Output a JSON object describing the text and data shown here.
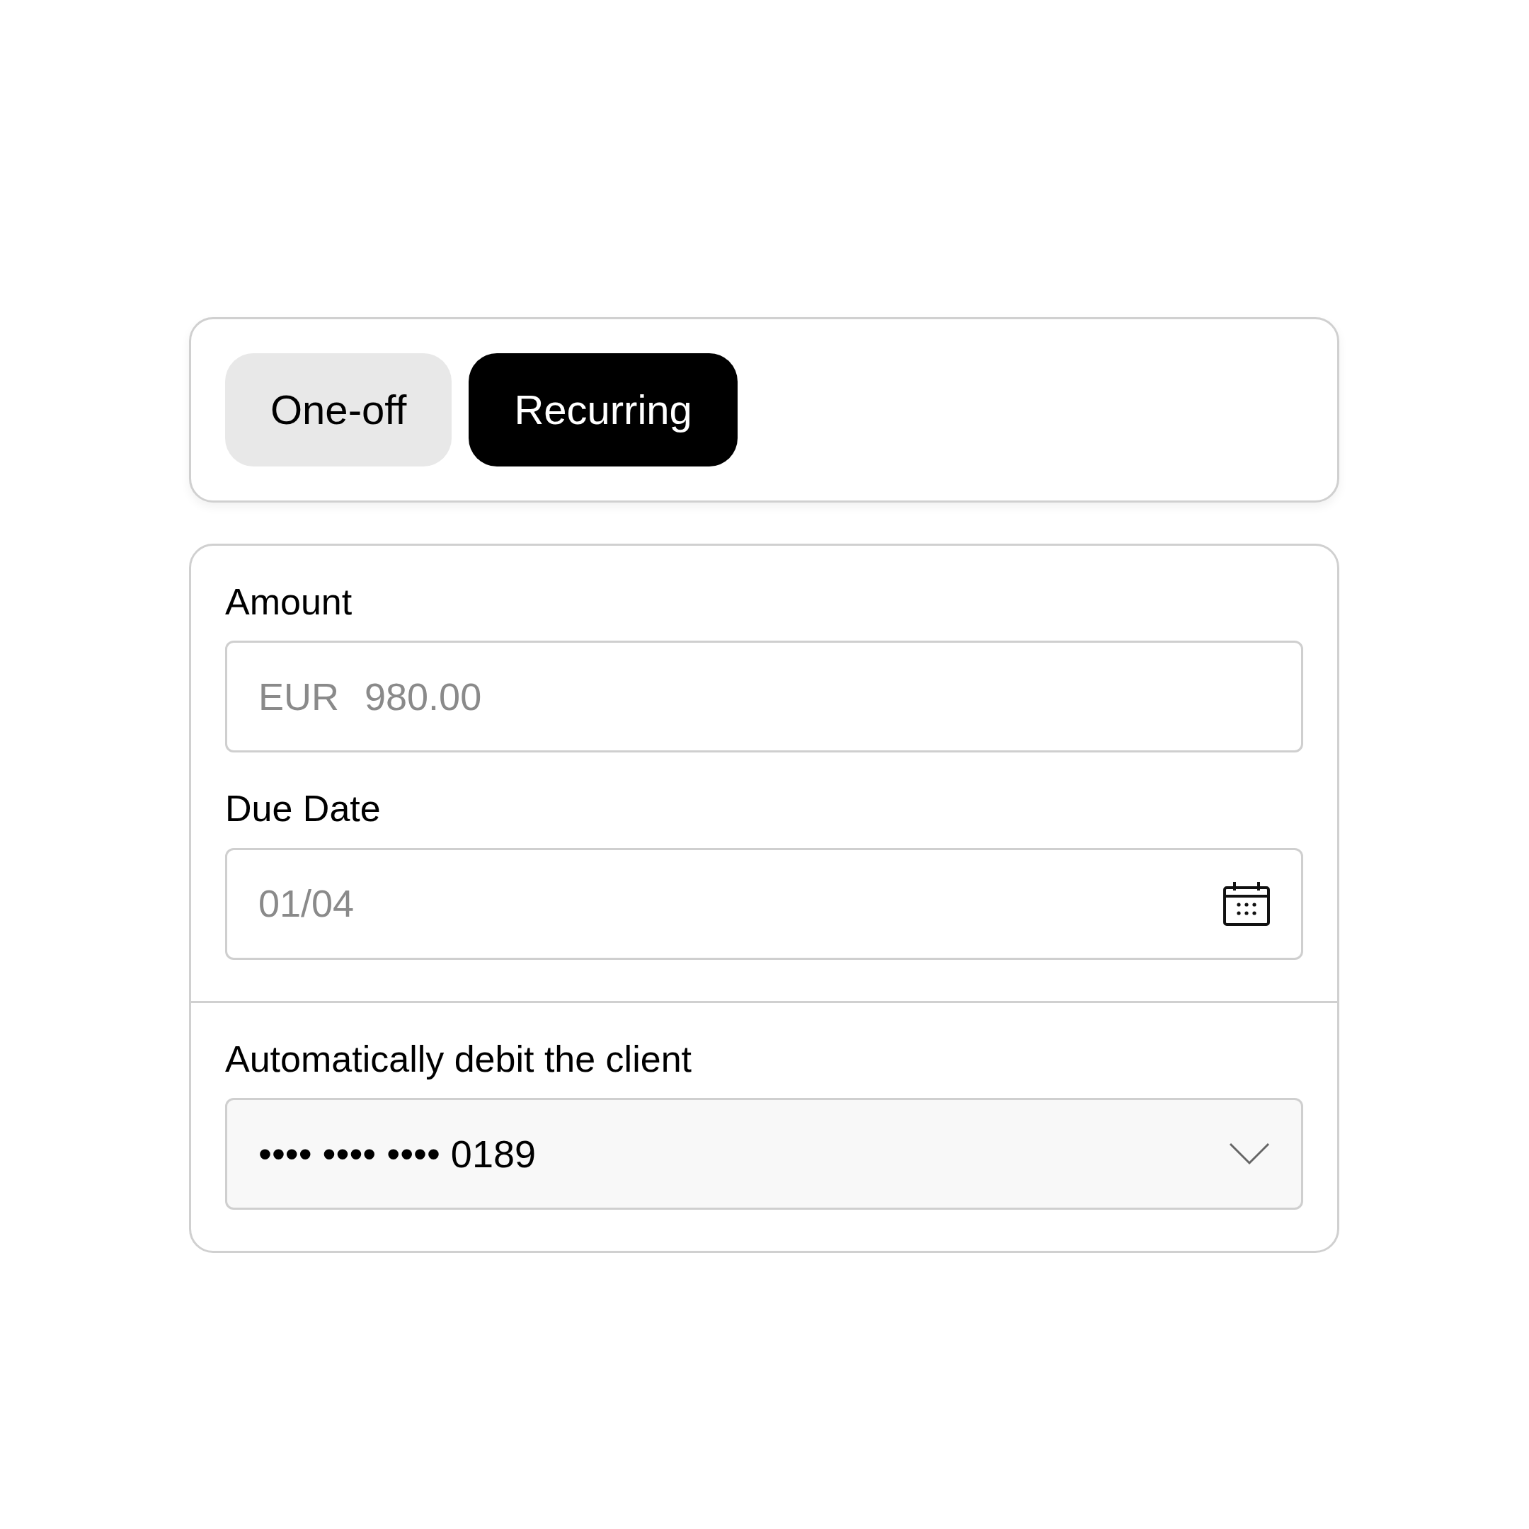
{
  "tabs": [
    {
      "label": "One-off",
      "selected": false
    },
    {
      "label": "Recurring",
      "selected": true
    }
  ],
  "amount": {
    "label": "Amount",
    "currency": "EUR",
    "placeholder": "980.00"
  },
  "due_date": {
    "label": "Due Date",
    "placeholder": "01/04"
  },
  "debit": {
    "label": "Automatically debit the client",
    "value": "•••• •••• •••• 0189"
  }
}
